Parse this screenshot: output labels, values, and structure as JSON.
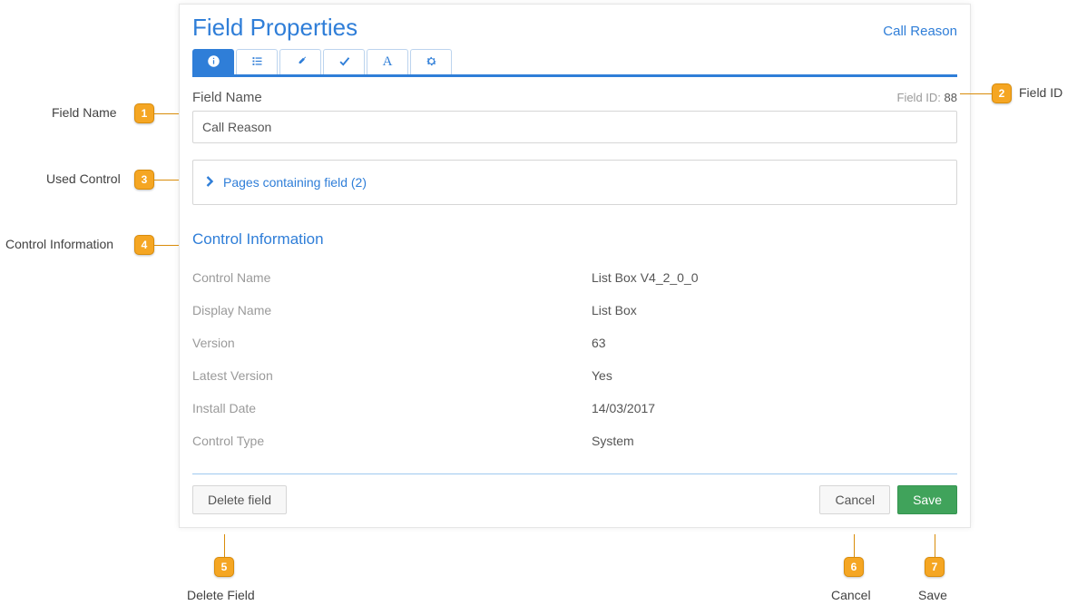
{
  "header": {
    "title": "Field Properties",
    "context": "Call Reason"
  },
  "tabs": {
    "info": "info-icon",
    "list": "list-icon",
    "eyedropper": "eyedropper-icon",
    "check": "check-icon",
    "text": "text-A-icon",
    "gear": "gear-icon"
  },
  "fieldName": {
    "label": "Field Name",
    "value": "Call Reason"
  },
  "fieldId": {
    "label": "Field ID:",
    "value": "88"
  },
  "pagesExpander": {
    "label": "Pages containing field (2)"
  },
  "controlInfo": {
    "title": "Control Information",
    "rows": [
      {
        "key": "Control Name",
        "val": "List Box V4_2_0_0"
      },
      {
        "key": "Display Name",
        "val": "List Box"
      },
      {
        "key": "Version",
        "val": "63"
      },
      {
        "key": "Latest Version",
        "val": "Yes"
      },
      {
        "key": "Install Date",
        "val": "14/03/2017"
      },
      {
        "key": "Control Type",
        "val": "System"
      }
    ]
  },
  "footer": {
    "delete": "Delete field",
    "cancel": "Cancel",
    "save": "Save"
  },
  "callouts": {
    "c1": {
      "num": "1",
      "label": "Field Name"
    },
    "c2": {
      "num": "2",
      "label": "Field ID"
    },
    "c3": {
      "num": "3",
      "label": "Used Control"
    },
    "c4": {
      "num": "4",
      "label": "Control Information"
    },
    "c5": {
      "num": "5",
      "label": "Delete Field"
    },
    "c6": {
      "num": "6",
      "label": "Cancel"
    },
    "c7": {
      "num": "7",
      "label": "Save"
    }
  }
}
